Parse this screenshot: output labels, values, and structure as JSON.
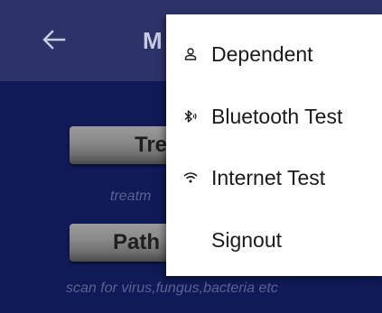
{
  "app_bar": {
    "title": "M",
    "back_icon": "arrow-left-icon"
  },
  "main": {
    "buttons": [
      {
        "label": "Tre",
        "caption": "treatm"
      },
      {
        "label": "Path",
        "caption": "scan for virus,fungus,bacteria etc"
      }
    ]
  },
  "menu": {
    "items": [
      {
        "label": "Dependent",
        "icon": "person-icon"
      },
      {
        "label": "Bluetooth Test",
        "icon": "bluetooth-icon"
      },
      {
        "label": "Internet Test",
        "icon": "wifi-icon"
      },
      {
        "label": "Signout",
        "icon": ""
      }
    ]
  },
  "colors": {
    "app_bar": "#2c3369",
    "background": "#101a57",
    "menu_bg": "#ffffff",
    "menu_text": "#1a1a1a"
  }
}
